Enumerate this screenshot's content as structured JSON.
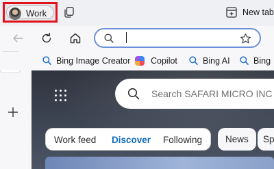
{
  "tab_strip": {
    "profile": {
      "label": "Work",
      "avatar_icon": "profile-photo"
    },
    "workspaces_icon": "workspaces-icon",
    "new_tab": {
      "label": "New tab",
      "icon": "new-tab-icon"
    }
  },
  "toolbar": {
    "back_icon": "back-arrow-icon",
    "refresh_icon": "refresh-icon",
    "home_icon": "home-icon",
    "address_bar": {
      "value": "",
      "search_icon": "search-icon",
      "favorite_icon": "star-icon"
    }
  },
  "favorites": [
    {
      "label": "Bing Image Creator",
      "icon": "search-icon"
    },
    {
      "label": "Copilot",
      "icon": "copilot-icon"
    },
    {
      "label": "Bing AI",
      "icon": "search-icon"
    },
    {
      "label": "Bing",
      "icon": "search-icon"
    }
  ],
  "sidebar": {
    "items": [
      {
        "icon": "tab-actions-icon"
      },
      {
        "icon": "calendar-icon",
        "active": true
      },
      {
        "icon": "add-icon"
      }
    ]
  },
  "new_tab_page": {
    "apps_icon": "app-launcher-icon",
    "search": {
      "placeholder": "Search SAFARI MICRO INC"
    },
    "feed_tabs": [
      {
        "label": "Work feed",
        "active": false
      },
      {
        "label": "Discover",
        "active": true
      },
      {
        "label": "Following",
        "active": false
      }
    ],
    "extra_tabs": [
      "News",
      "Sp"
    ]
  },
  "colors": {
    "highlight_border": "#e0121b",
    "address_focus": "#6b8fd8",
    "active_tab": "#0f6cbd"
  }
}
